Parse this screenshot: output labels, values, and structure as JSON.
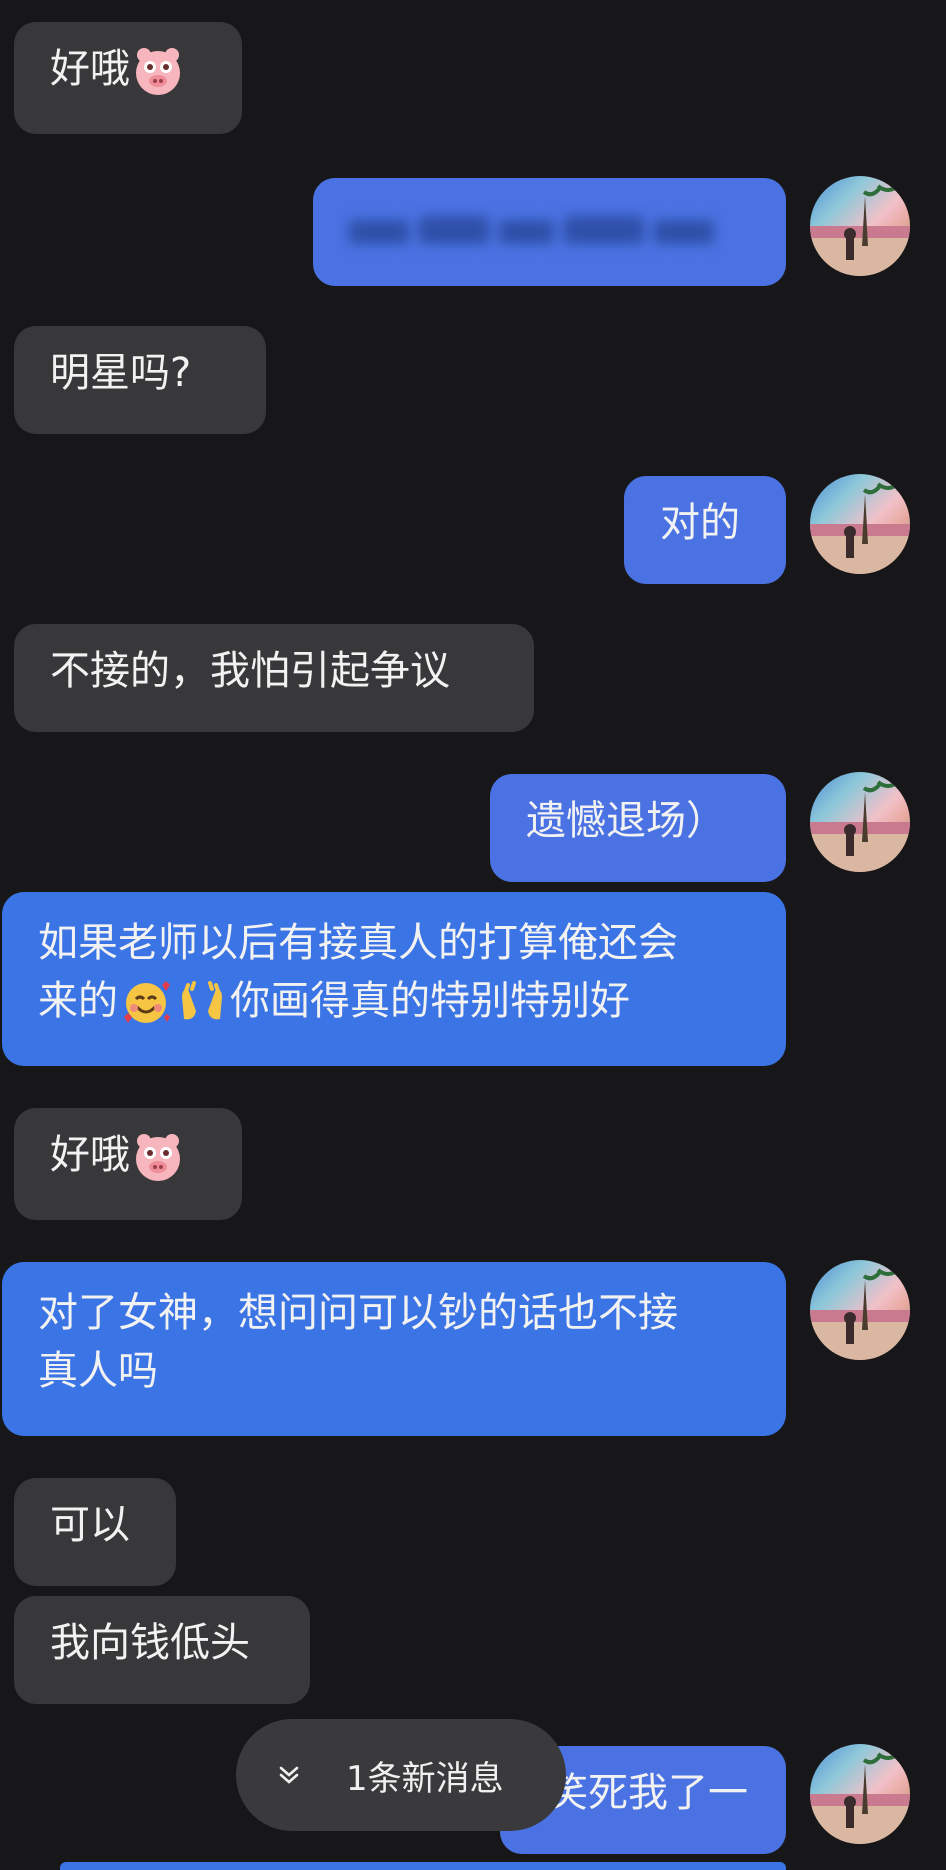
{
  "messages": [
    {
      "side": "left",
      "text": "好哦",
      "emoji": "pig"
    },
    {
      "side": "right",
      "text": "",
      "blurred": true
    },
    {
      "side": "left",
      "text": "明星吗?"
    },
    {
      "side": "right",
      "text": "对的"
    },
    {
      "side": "left",
      "text": "不接的，我怕引起争议"
    },
    {
      "side": "right",
      "text": "遗憾退场）"
    },
    {
      "side": "right",
      "line1": "如果老师以后有接真人的打算俺还会",
      "line2a": "来的",
      "line2b": "你画得真的特别特别好"
    },
    {
      "side": "left",
      "text": "好哦",
      "emoji": "pig"
    },
    {
      "side": "right",
      "line1": "对了女神，想问问可以钞的话也不接",
      "line2": "真人吗"
    },
    {
      "side": "left",
      "text": "可以"
    },
    {
      "side": "left",
      "text": "我向钱低头"
    },
    {
      "side": "right",
      "text": "笑死我了一"
    }
  ],
  "new_message_pill": {
    "label": "1条新消息",
    "icon": "double-chevron-down-icon"
  },
  "colors": {
    "background": "#171719",
    "left_bubble": "#38383a",
    "right_bubble": "#4a72e2"
  }
}
